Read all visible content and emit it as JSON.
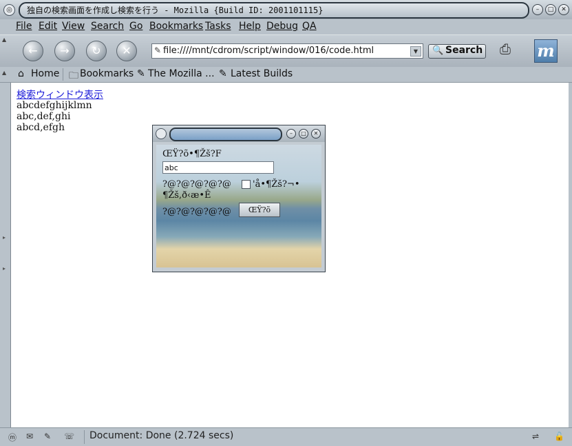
{
  "window": {
    "title": "独自の検索画面を作成し検索を行う - Mozilla {Build ID: 2001101115}"
  },
  "menu": [
    "File",
    "Edit",
    "View",
    "Search",
    "Go",
    "Bookmarks",
    "Tasks",
    "Help",
    "Debug",
    "QA"
  ],
  "nav": {
    "url": "file:////mnt/cdrom/script/window/016/code.html",
    "search_label": "Search"
  },
  "personal_toolbar": {
    "home": "Home",
    "bookmarks": "Bookmarks",
    "mozilla": "The Mozilla ...",
    "latest_builds": "Latest Builds"
  },
  "page": {
    "link": "検索ウィンドウ表示",
    "lines": [
      "abcdefghijklmn",
      "abc,def,ghi",
      "abcd,efgh"
    ]
  },
  "popup": {
    "label1": "ŒŸ?õ•¶Žš?F",
    "input_value": "abc",
    "row2_text": "?@?@?@?@?@",
    "row2_after": "'å•¶Žš?¬•",
    "row3": "¶Žš,ð‹æ•Ê",
    "row4_text": "?@?@?@?@?@",
    "button": "ŒŸ?õ"
  },
  "status": {
    "text": "Document: Done (2.724 secs)"
  }
}
